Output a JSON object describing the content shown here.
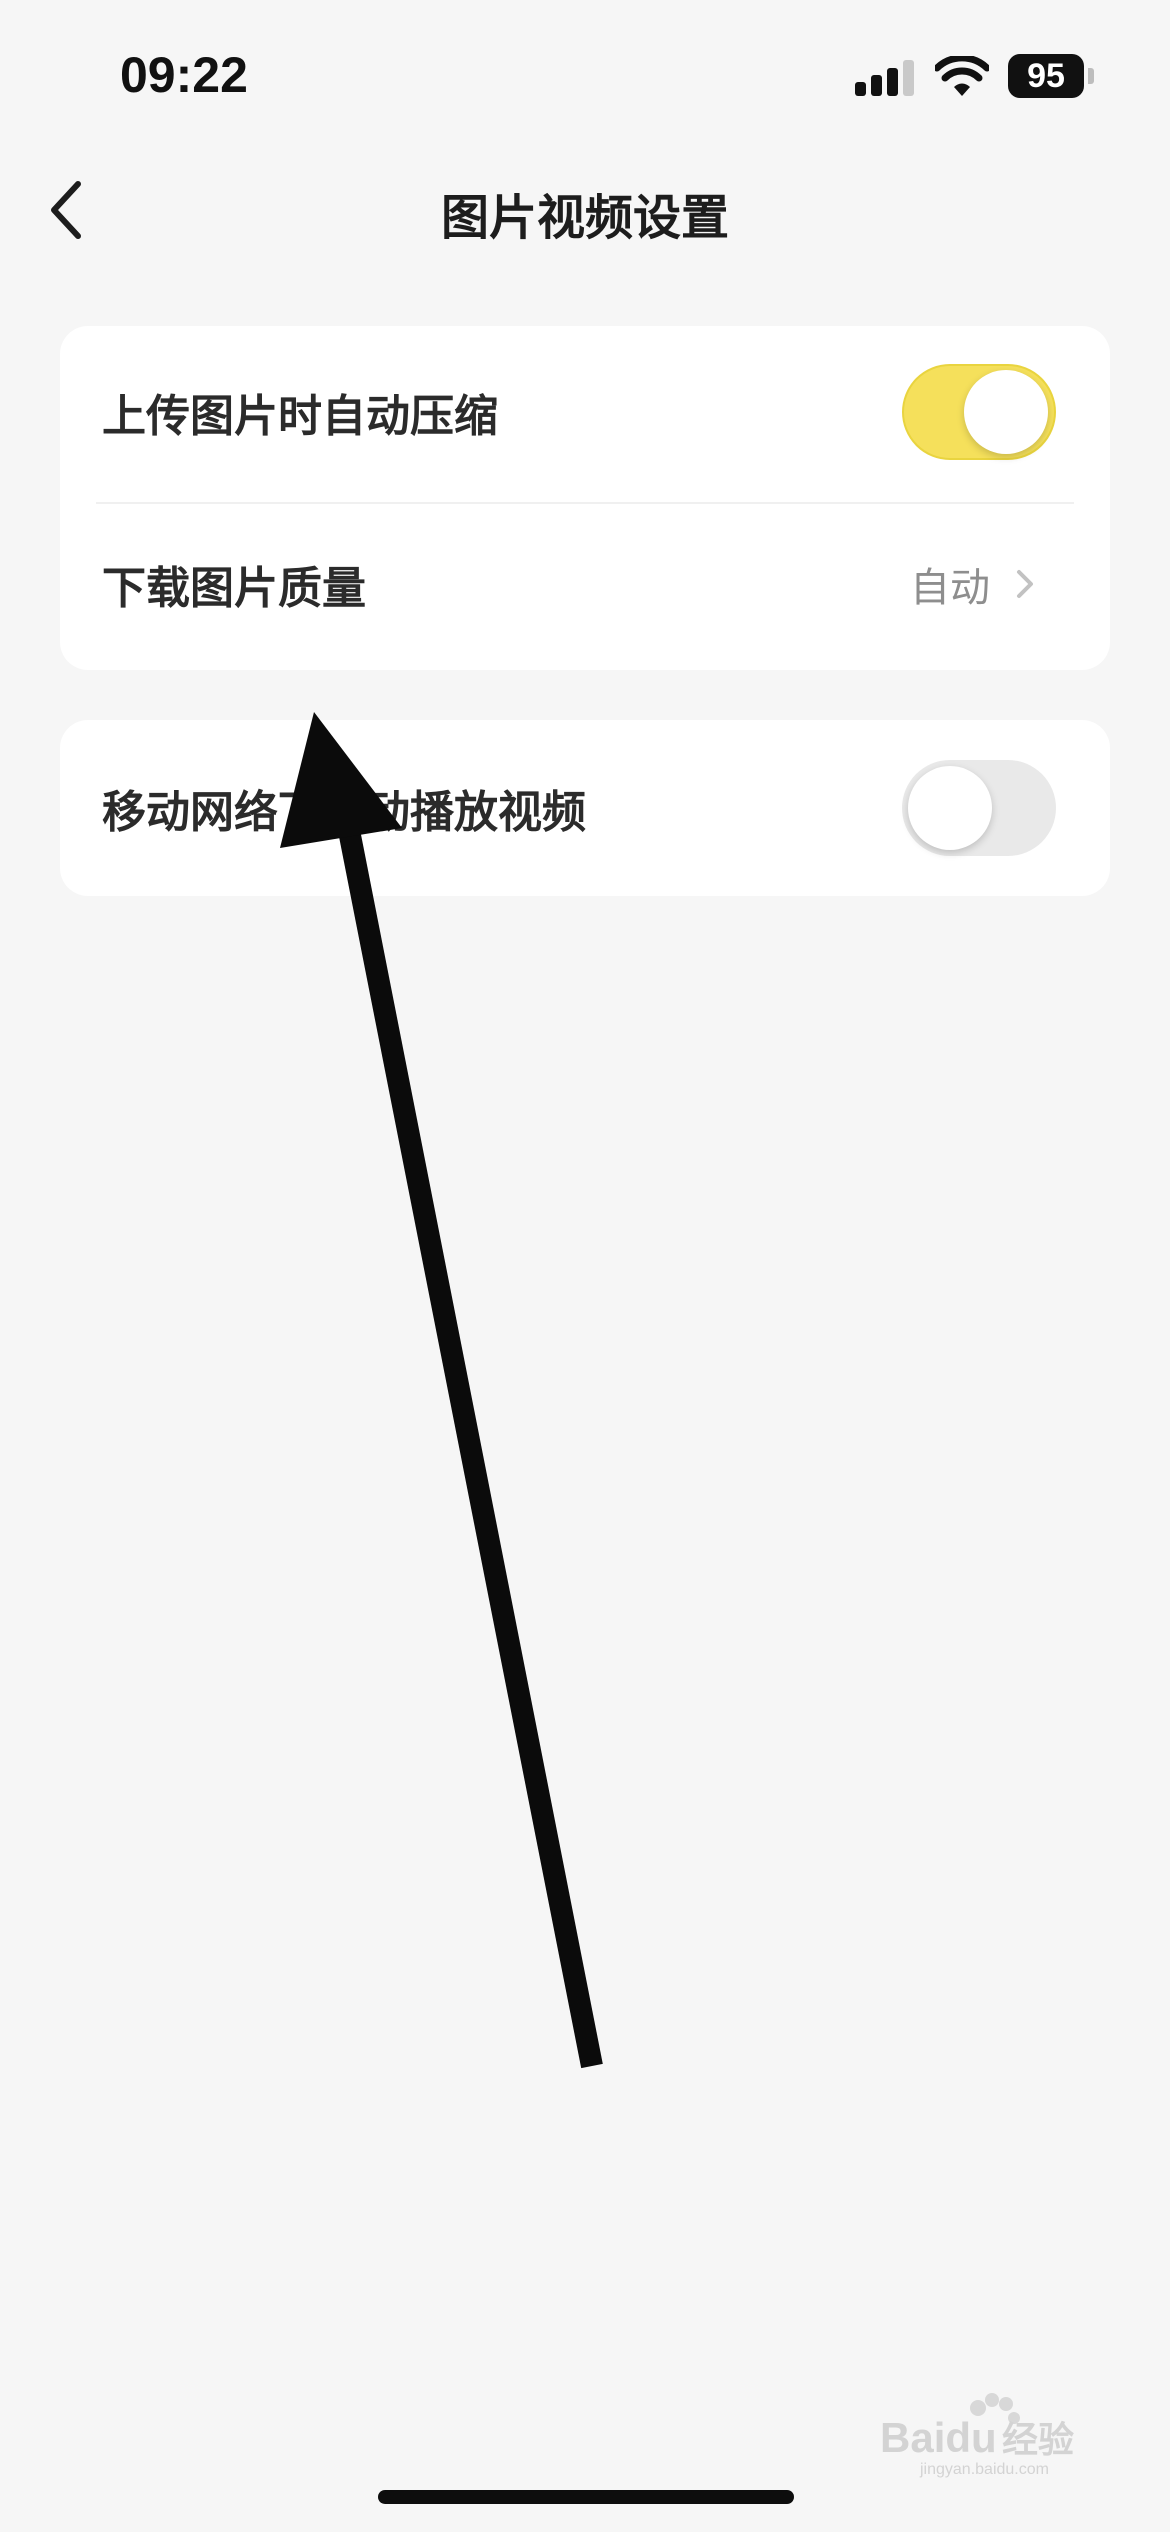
{
  "status_bar": {
    "time": "09:22",
    "battery": "95"
  },
  "nav": {
    "title": "图片视频设置"
  },
  "settings": {
    "compress_label": "上传图片时自动压缩",
    "compress_on": true,
    "quality_label": "下载图片质量",
    "quality_value": "自动",
    "autoplay_label": "移动网络下自动播放视频",
    "autoplay_on": false
  },
  "colors": {
    "accent": "#f5e05b",
    "background": "#f6f6f6"
  },
  "watermark": {
    "text": "Baidu经验",
    "url": "jingyan.baidu.com"
  }
}
